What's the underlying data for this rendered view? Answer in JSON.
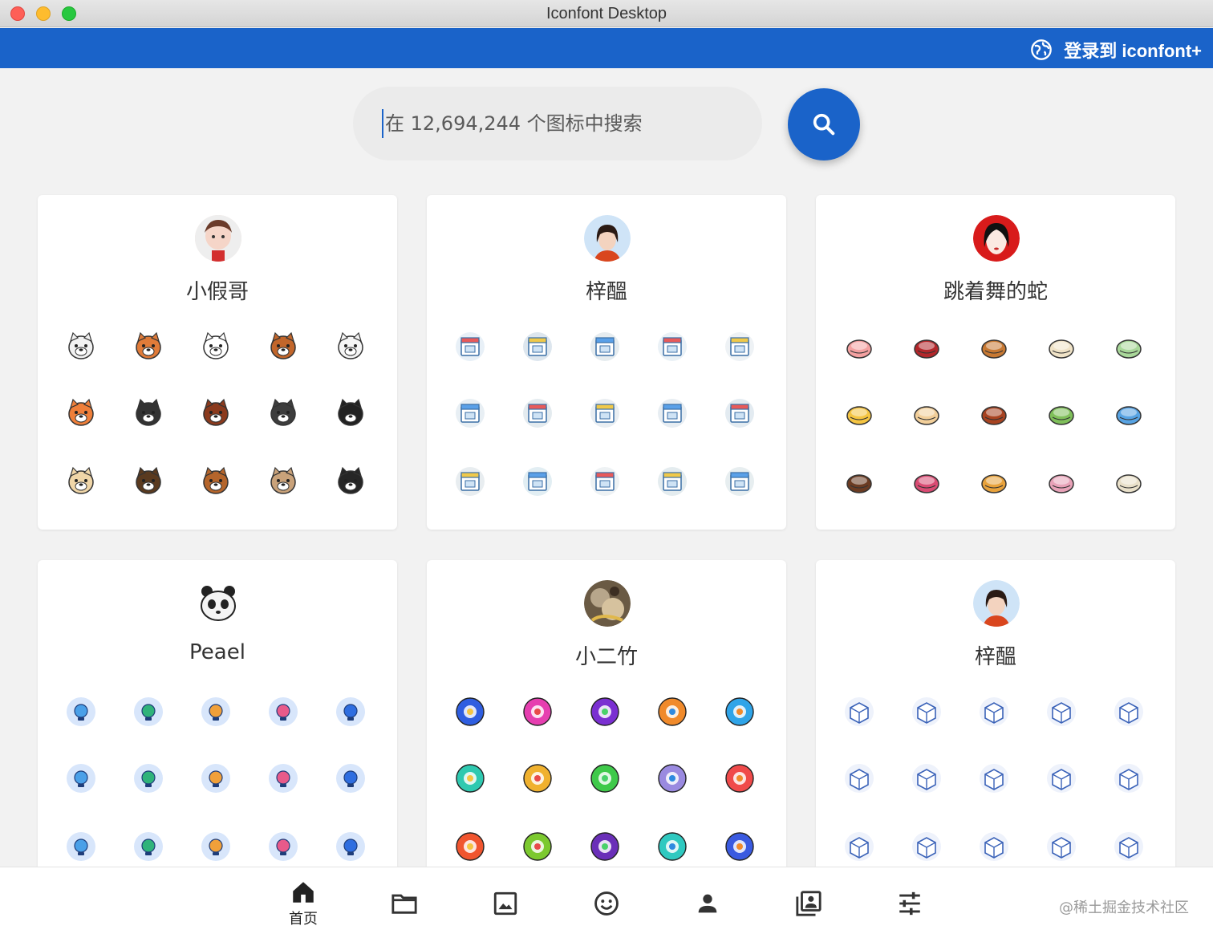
{
  "window": {
    "title": "Iconfont Desktop"
  },
  "header": {
    "login_label": "登录到 iconfont+"
  },
  "search": {
    "placeholder": "在 12,694,244 个图标中搜索",
    "value": ""
  },
  "cards": [
    {
      "user": "小假哥",
      "theme": "dogs",
      "icon_names": [
        "poodle-icon",
        "shiba-icon",
        "samoyed-icon",
        "chipmunk-icon",
        "cat-icon",
        "fox-icon",
        "husky-icon",
        "mastiff-icon",
        "panda-dog-icon",
        "papillon-icon",
        "corgi-icon",
        "german-shepherd-icon",
        "yorkie-icon",
        "pug-icon",
        "spaniel-icon"
      ]
    },
    {
      "user": "梓醞",
      "theme": "shops",
      "icon_names": [
        "store-icon",
        "delivery-truck-icon",
        "vending-machine-icon",
        "market-icon",
        "warehouse-icon",
        "video-board-icon",
        "invoice-icon",
        "worker-icon",
        "clipboard-icon",
        "printer-icon",
        "security-box-icon",
        "wallet-icon",
        "cart-icon",
        "edit-order-icon",
        "image-frame-icon"
      ]
    },
    {
      "user": "跳着舞的蛇",
      "theme": "food",
      "icon_names": [
        "cake-icon",
        "steak-icon",
        "burger-icon",
        "noodles-icon",
        "leaf-snack-icon",
        "pudding-icon",
        "pizza-icon",
        "sausage-icon",
        "salad-icon",
        "milk-box-icon",
        "donut-icon",
        "lollipop-icon",
        "croissant-icon",
        "ice-cream-icon",
        "rice-ball-icon"
      ]
    },
    {
      "user": "Peael",
      "theme": "travel",
      "icon_names": [
        "balloon-icon",
        "bottle-icon",
        "fan-icon",
        "molecule-icon",
        "star-badge-icon",
        "bath-icon",
        "hummingbird-icon",
        "kid-icon",
        "sushi-icon",
        "tower-icon",
        "onsen-icon",
        "sunrise-icon",
        "luggage-icon",
        "tree-icon",
        "plant-icon"
      ]
    },
    {
      "user": "小二竹",
      "theme": "colorful",
      "icon_names": [
        "sun-icon",
        "jar-icon",
        "strawberry-icon",
        "coffee-icon",
        "orange-icon",
        "gamepad-icon",
        "bag-icon",
        "search-fruit-icon",
        "barcode-icon",
        "smile-icon",
        "phone-icon",
        "bulb-icon",
        "cup-icon",
        "wallet-color-icon",
        "drink-icon"
      ]
    },
    {
      "user": "梓醞",
      "theme": "logistics",
      "icon_names": [
        "return-box-icon",
        "package-icon",
        "inspect-icon",
        "truck-icon",
        "hand-box-icon",
        "van-icon",
        "home-delivery-icon",
        "ship-icon",
        "parcel-list-icon",
        "care-box-icon",
        "delivery-2d-icon",
        "scale-icon",
        "open-box-icon",
        "plane-icon",
        "courier-icon"
      ]
    }
  ],
  "bottom_nav": [
    {
      "icon": "home-icon",
      "label": "首页"
    },
    {
      "icon": "folder-icon",
      "label": ""
    },
    {
      "icon": "image-icon",
      "label": ""
    },
    {
      "icon": "emoji-icon",
      "label": ""
    },
    {
      "icon": "person-icon",
      "label": ""
    },
    {
      "icon": "collections-icon",
      "label": ""
    },
    {
      "icon": "tune-icon",
      "label": ""
    }
  ],
  "watermark": "@稀土掘金技术社区",
  "colors": {
    "primary": "#1a63c9",
    "background": "#f2f2f2"
  }
}
